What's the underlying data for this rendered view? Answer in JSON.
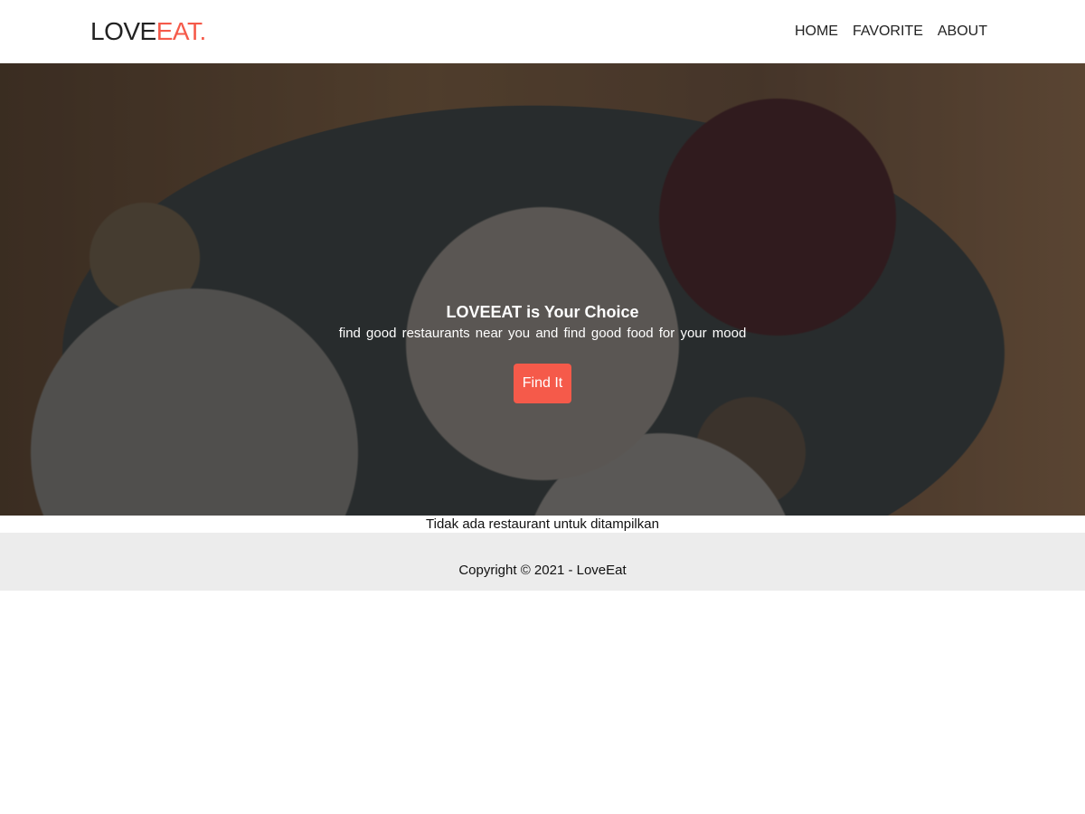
{
  "header": {
    "logo_part1": "LOVE",
    "logo_part2": "EAT.",
    "nav": [
      "HOME",
      "FAVORITE",
      "ABOUT"
    ]
  },
  "hero": {
    "title": "LOVEEAT is Your Choice",
    "subtitle": "find good restaurants near you and find good food for your mood",
    "button": "Find It"
  },
  "main": {
    "empty_message": "Tidak ada restaurant untuk ditampilkan"
  },
  "footer": {
    "copyright": "Copyright © 2021 - LoveEat"
  },
  "colors": {
    "accent": "#f55a4a"
  }
}
